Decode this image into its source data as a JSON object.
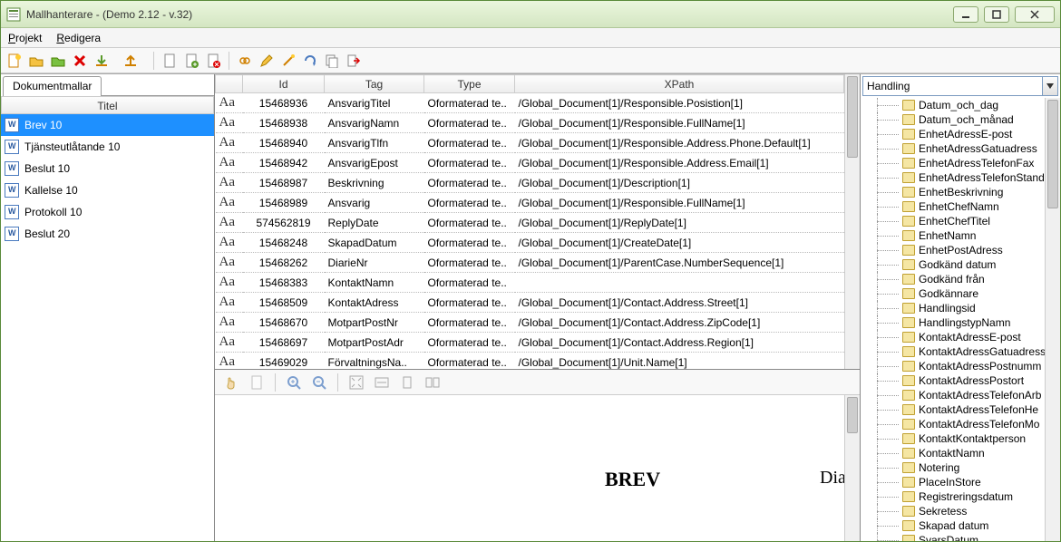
{
  "window": {
    "title": "Mallhanterare - (Demo 2.12 - v.32)"
  },
  "menu": {
    "projekt": "Projekt",
    "redigera": "Redigera"
  },
  "left": {
    "tab": "Dokumentmallar",
    "header": "Titel",
    "items": [
      "Brev 10",
      "Tjänsteutlåtande 10",
      "Beslut 10",
      "Kallelse 10",
      "Protokoll 10",
      "Beslut 20"
    ],
    "selected": 0
  },
  "grid": {
    "cols": {
      "id": "Id",
      "tag": "Tag",
      "type": "Type",
      "xpath": "XPath"
    },
    "aa": "Aa",
    "typeVal": "Oformaterad te..",
    "rows": [
      {
        "id": "15468936",
        "tag": "AnsvarigTitel",
        "xpath": "/Global_Document[1]/Responsible.Posistion[1]"
      },
      {
        "id": "15468938",
        "tag": "AnsvarigNamn",
        "xpath": "/Global_Document[1]/Responsible.FullName[1]"
      },
      {
        "id": "15468940",
        "tag": "AnsvarigTlfn",
        "xpath": "/Global_Document[1]/Responsible.Address.Phone.Default[1]"
      },
      {
        "id": "15468942",
        "tag": "AnsvarigEpost",
        "xpath": "/Global_Document[1]/Responsible.Address.Email[1]"
      },
      {
        "id": "15468987",
        "tag": "Beskrivning",
        "xpath": "/Global_Document[1]/Description[1]"
      },
      {
        "id": "15468989",
        "tag": "Ansvarig",
        "xpath": "/Global_Document[1]/Responsible.FullName[1]"
      },
      {
        "id": "574562819",
        "tag": "ReplyDate",
        "xpath": "/Global_Document[1]/ReplyDate[1]"
      },
      {
        "id": "15468248",
        "tag": "SkapadDatum",
        "xpath": "/Global_Document[1]/CreateDate[1]"
      },
      {
        "id": "15468262",
        "tag": "DiarieNr",
        "xpath": "/Global_Document[1]/ParentCase.NumberSequence[1]"
      },
      {
        "id": "15468383",
        "tag": "KontaktNamn",
        "xpath": ""
      },
      {
        "id": "15468509",
        "tag": "KontaktAdress",
        "xpath": "/Global_Document[1]/Contact.Address.Street[1]"
      },
      {
        "id": "15468670",
        "tag": "MotpartPostNr",
        "xpath": "/Global_Document[1]/Contact.Address.ZipCode[1]"
      },
      {
        "id": "15468697",
        "tag": "MotpartPostAdr",
        "xpath": "/Global_Document[1]/Contact.Address.Region[1]"
      },
      {
        "id": "15469029",
        "tag": "FörvaltningsNa..",
        "xpath": "/Global_Document[1]/Unit.Name[1]"
      }
    ]
  },
  "preview": {
    "title": "BREV",
    "right": "Diarien"
  },
  "right": {
    "combo": "Handling",
    "items": [
      "Datum_och_dag",
      "Datum_och_månad",
      "EnhetAdressE-post",
      "EnhetAdressGatuadress",
      "EnhetAdressTelefonFax",
      "EnhetAdressTelefonStand",
      "EnhetBeskrivning",
      "EnhetChefNamn",
      "EnhetChefTitel",
      "EnhetNamn",
      "EnhetPostAdress",
      "Godkänd datum",
      "Godkänd från",
      "Godkännare",
      "Handlingsid",
      "HandlingstypNamn",
      "KontaktAdressE-post",
      "KontaktAdressGatuadress",
      "KontaktAdressPostnumm",
      "KontaktAdressPostort",
      "KontaktAdressTelefonArb",
      "KontaktAdressTelefonHe",
      "KontaktAdressTelefonMo",
      "KontaktKontaktperson",
      "KontaktNamn",
      "Notering",
      "PlaceInStore",
      "Registreringsdatum",
      "Sekretess",
      "Skapad datum",
      "SvarsDatum"
    ]
  }
}
